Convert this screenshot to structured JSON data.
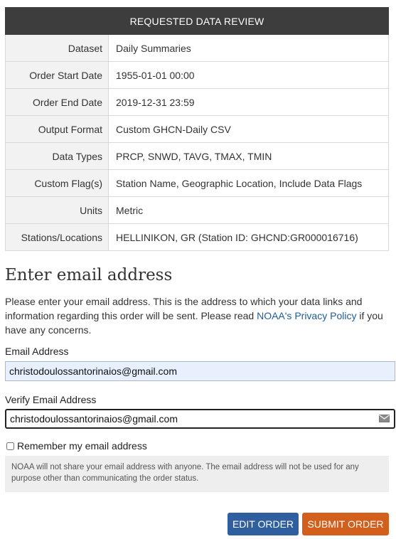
{
  "review": {
    "heading": "REQUESTED DATA REVIEW",
    "rows": [
      {
        "label": "Dataset",
        "value": "Daily Summaries"
      },
      {
        "label": "Order Start Date",
        "value": "1955-01-01 00:00"
      },
      {
        "label": "Order End Date",
        "value": "2019-12-31 23:59"
      },
      {
        "label": "Output Format",
        "value": "Custom GHCN-Daily CSV"
      },
      {
        "label": "Data Types",
        "value": "PRCP, SNWD, TAVG, TMAX, TMIN"
      },
      {
        "label": "Custom Flag(s)",
        "value": "Station Name, Geographic Location, Include Data Flags"
      },
      {
        "label": "Units",
        "value": "Metric"
      },
      {
        "label": "Stations/Locations",
        "value": "HELLINIKON, GR (Station ID: GHCND:GR000016716)"
      }
    ]
  },
  "email_section": {
    "title": "Enter email address",
    "intro_before": "Please enter your email address. This is the address to which your data links and information regarding this order will be sent. Please read ",
    "privacy_link": "NOAA's Privacy Policy",
    "intro_after": " if you have any concerns.",
    "email_label": "Email Address",
    "email_value": "christodoulossantorinaios@gmail.com",
    "verify_label": "Verify Email Address",
    "verify_value": "christodoulossantorinaios@gmail.com",
    "verify_icon": "mail-icon",
    "remember_label": "Remember my email address",
    "remember_checked": false,
    "notice": "NOAA will not share your email address with anyone. The email address will not be used for any purpose other than communicating the order status."
  },
  "actions": {
    "edit_label": "EDIT ORDER",
    "submit_label": "SUBMIT ORDER"
  },
  "colors": {
    "table_header_bg": "#3d3d3d",
    "link": "#1f5c99",
    "edit_button": "#2f5f9e",
    "submit_button": "#d25f1c",
    "autofill_bg": "#e8f0fe"
  }
}
